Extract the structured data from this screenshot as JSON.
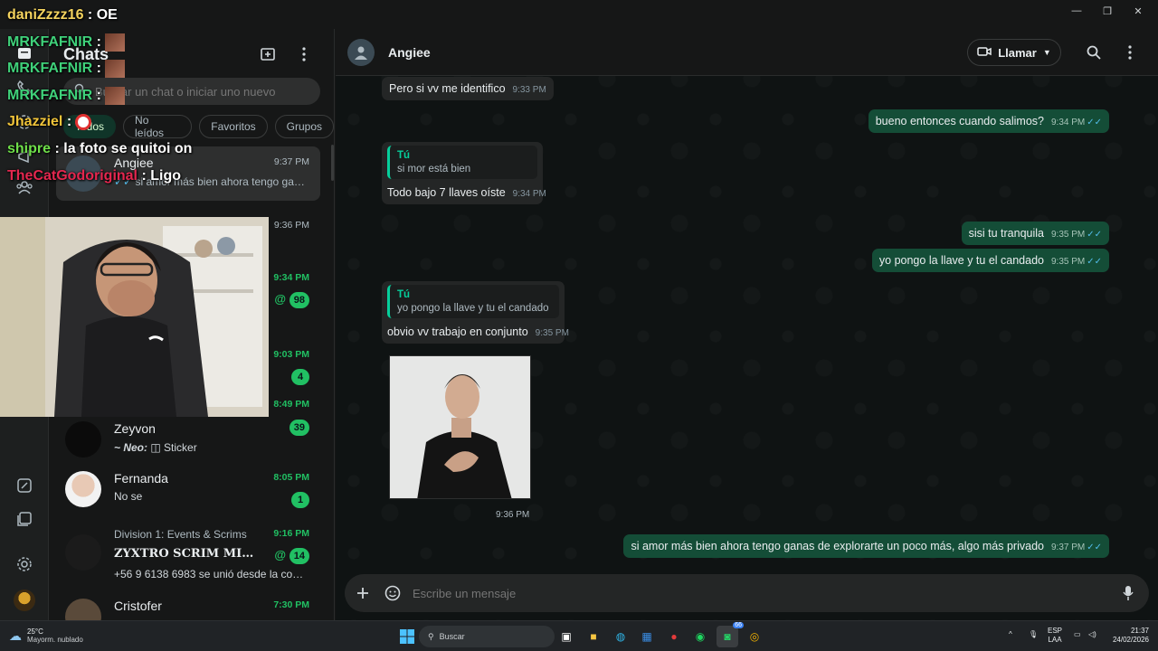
{
  "chat_list": {
    "title": "Chats",
    "search_placeholder": "Buscar un chat o iniciar uno nuevo",
    "filters": [
      "Todos",
      "No leídos",
      "Favoritos",
      "Grupos"
    ],
    "items": [
      {
        "name": "Angiee",
        "time": "9:37 PM",
        "preview": "si amor más bien ahora tengo gana..."
      },
      {
        "time": "9:36 PM"
      },
      {
        "time": "9:34 PM",
        "badge": "98",
        "mention": "@"
      },
      {
        "time": "9:03 PM",
        "badge": "4"
      },
      {
        "time": "8:49 PM"
      },
      {
        "name": "Zeyvon",
        "preview_author": "~ Neo:",
        "preview": "Sticker",
        "badge": "39"
      },
      {
        "name": "Fernanda",
        "time": "8:05 PM",
        "preview": "No se",
        "badge": "1"
      },
      {
        "group": "Division 1: Events & Scrims",
        "name": "ZYXTRO SCRIM MIXTA A...",
        "time": "9:16 PM",
        "preview": "+56 9 6138 6983 se unió desde la comu...",
        "badge": "14",
        "mention": "@"
      },
      {
        "name": "Cristofer",
        "time": "7:30 PM"
      }
    ]
  },
  "conversation": {
    "contact": "Angiee",
    "call_label": "Llamar",
    "composer_placeholder": "Escribe un mensaje",
    "messages": [
      {
        "text": "Pero si vv me identifico",
        "time": "9:33 PM"
      },
      {
        "text": "bueno entonces cuando salimos?",
        "time": "9:34 PM"
      },
      {
        "quote_author": "Tú",
        "quote_text": "si mor está bien",
        "text": "Todo bajo 7 llaves oíste",
        "time": "9:34 PM"
      },
      {
        "text": "sisi tu tranquila",
        "time": "9:35 PM"
      },
      {
        "text": "yo pongo la llave y tu el candado",
        "time": "9:35 PM"
      },
      {
        "quote_author": "Tú",
        "quote_text": "yo pongo la llave y tu el candado",
        "text": "obvio vv trabajo en conjunto",
        "time": "9:35 PM"
      },
      {
        "time": "9:36 PM"
      },
      {
        "text": "si amor más bien ahora tengo ganas de explorarte un poco más, algo más privado",
        "time": "9:37 PM"
      }
    ]
  },
  "stream_overlay": {
    "lines": [
      {
        "user": "daniZzzz16",
        "message": ": OE",
        "color": "#f4d35e"
      },
      {
        "user": "MRKFAFNIR",
        "message": ":",
        "color": "#3fd17a"
      },
      {
        "user": "MRKFAFNIR",
        "message": ":",
        "color": "#3fd17a"
      },
      {
        "user": "MRKFAFNIR",
        "message": ":",
        "color": "#3fd17a"
      },
      {
        "user": "Jhazziel",
        "message": ":",
        "color": "#f0c43a"
      },
      {
        "user": "shipre",
        "message": ": la foto se quitoi on",
        "color": "#6fe04a"
      },
      {
        "user": "TheCatGodoriginal",
        "message": ": Ligo",
        "color": "#e4274f"
      }
    ]
  },
  "taskbar": {
    "temperature": "25°C",
    "weather": "Mayorm. nublado",
    "search_label": "Buscar",
    "lang_line1": "ESP",
    "lang_line2": "LAA",
    "clock_time": "21:37",
    "clock_date": "24/02/2026",
    "whatsapp_badge": "66"
  },
  "colors": {
    "accent": "#21c063",
    "outgoing_bubble": "#144d37",
    "incoming_bubble": "#242626",
    "background": "#0f1313"
  }
}
